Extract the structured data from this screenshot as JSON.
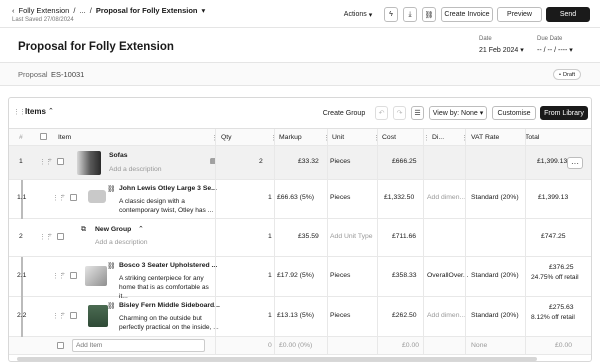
{
  "breadcrumb": {
    "project": "Folly Extension",
    "ellipsis": "...",
    "current": "Proposal for Folly Extension",
    "sep": "/"
  },
  "saved": "Last Saved 27/08/2024",
  "toolbar": {
    "actions": "Actions",
    "create_invoice": "Create Invoice",
    "preview": "Preview",
    "send": "Send"
  },
  "header": {
    "title": "Proposal for Folly Extension",
    "date_label": "Date",
    "date_value": "21 Feb 2024",
    "due_label": "Due Date",
    "due_value": "-- / -- / ----",
    "proposal_label": "Proposal",
    "proposal_number": "ES-10031",
    "status": "Draft"
  },
  "items": {
    "heading": "Items",
    "create_group": "Create Group",
    "view_by": "View by: None",
    "customise": "Customise",
    "from_library": "From Library",
    "columns": {
      "num": "#",
      "item": "Item",
      "qty": "Qty",
      "markup": "Markup",
      "unit": "Unit",
      "cost": "Cost",
      "di": "Di...",
      "vat": "VAT Rate",
      "total": "Total"
    },
    "rows": [
      {
        "num": "1",
        "name": "Sofas",
        "desc": "Add a description",
        "qty": "2",
        "markup": "£33.32",
        "unit": "Pieces",
        "cost": "£666.25",
        "di": "",
        "vat": "",
        "total": "£1,399.13"
      },
      {
        "num": "1.1",
        "name": "John Lewis Otley Large 3 Se...",
        "desc": "A classic design with a contemporary twist, Otley has ...",
        "qty": "1",
        "markup": "£66.63 (5%)",
        "unit": "Pieces",
        "cost": "£1,332.50",
        "di": "Add dimen...",
        "vat": "Standard (20%)",
        "total": "£1,399.13"
      },
      {
        "num": "2",
        "name": "New Group",
        "desc": "Add a description",
        "qty": "1",
        "markup": "£35.59",
        "unit": "Add Unit Type",
        "cost": "£711.66",
        "di": "",
        "vat": "",
        "total": "£747.25"
      },
      {
        "num": "2.1",
        "name": "Bosco 3 Seater Upholstered ...",
        "desc": "A striking centerpiece for any home that is as comfortable as it...",
        "qty": "1",
        "markup": "£17.92 (5%)",
        "unit": "Pieces",
        "cost": "£358.33",
        "di": "OverallOver...",
        "vat": "Standard (20%)",
        "total": "£376.25",
        "total_note": "24.75% off retail"
      },
      {
        "num": "2.2",
        "name": "Bisley Fern Middle Sideboard...",
        "desc": "Charming on the outside but perfectly practical on the inside, ...",
        "qty": "1",
        "markup": "£13.13 (5%)",
        "unit": "Pieces",
        "cost": "£262.50",
        "di": "Add dimen...",
        "vat": "Standard (20%)",
        "total": "£275.63",
        "total_note": "8.12% off retail"
      }
    ],
    "add_row": {
      "placeholder": "Add Item",
      "qty": "0",
      "markup": "£0.00 (0%)",
      "cost": "£0.00",
      "vat": "None",
      "total": "£0.00"
    }
  },
  "colors": {
    "dark": "#1a1a1a",
    "border": "#e5e5e5",
    "group_bg": "#f1f1f1"
  }
}
